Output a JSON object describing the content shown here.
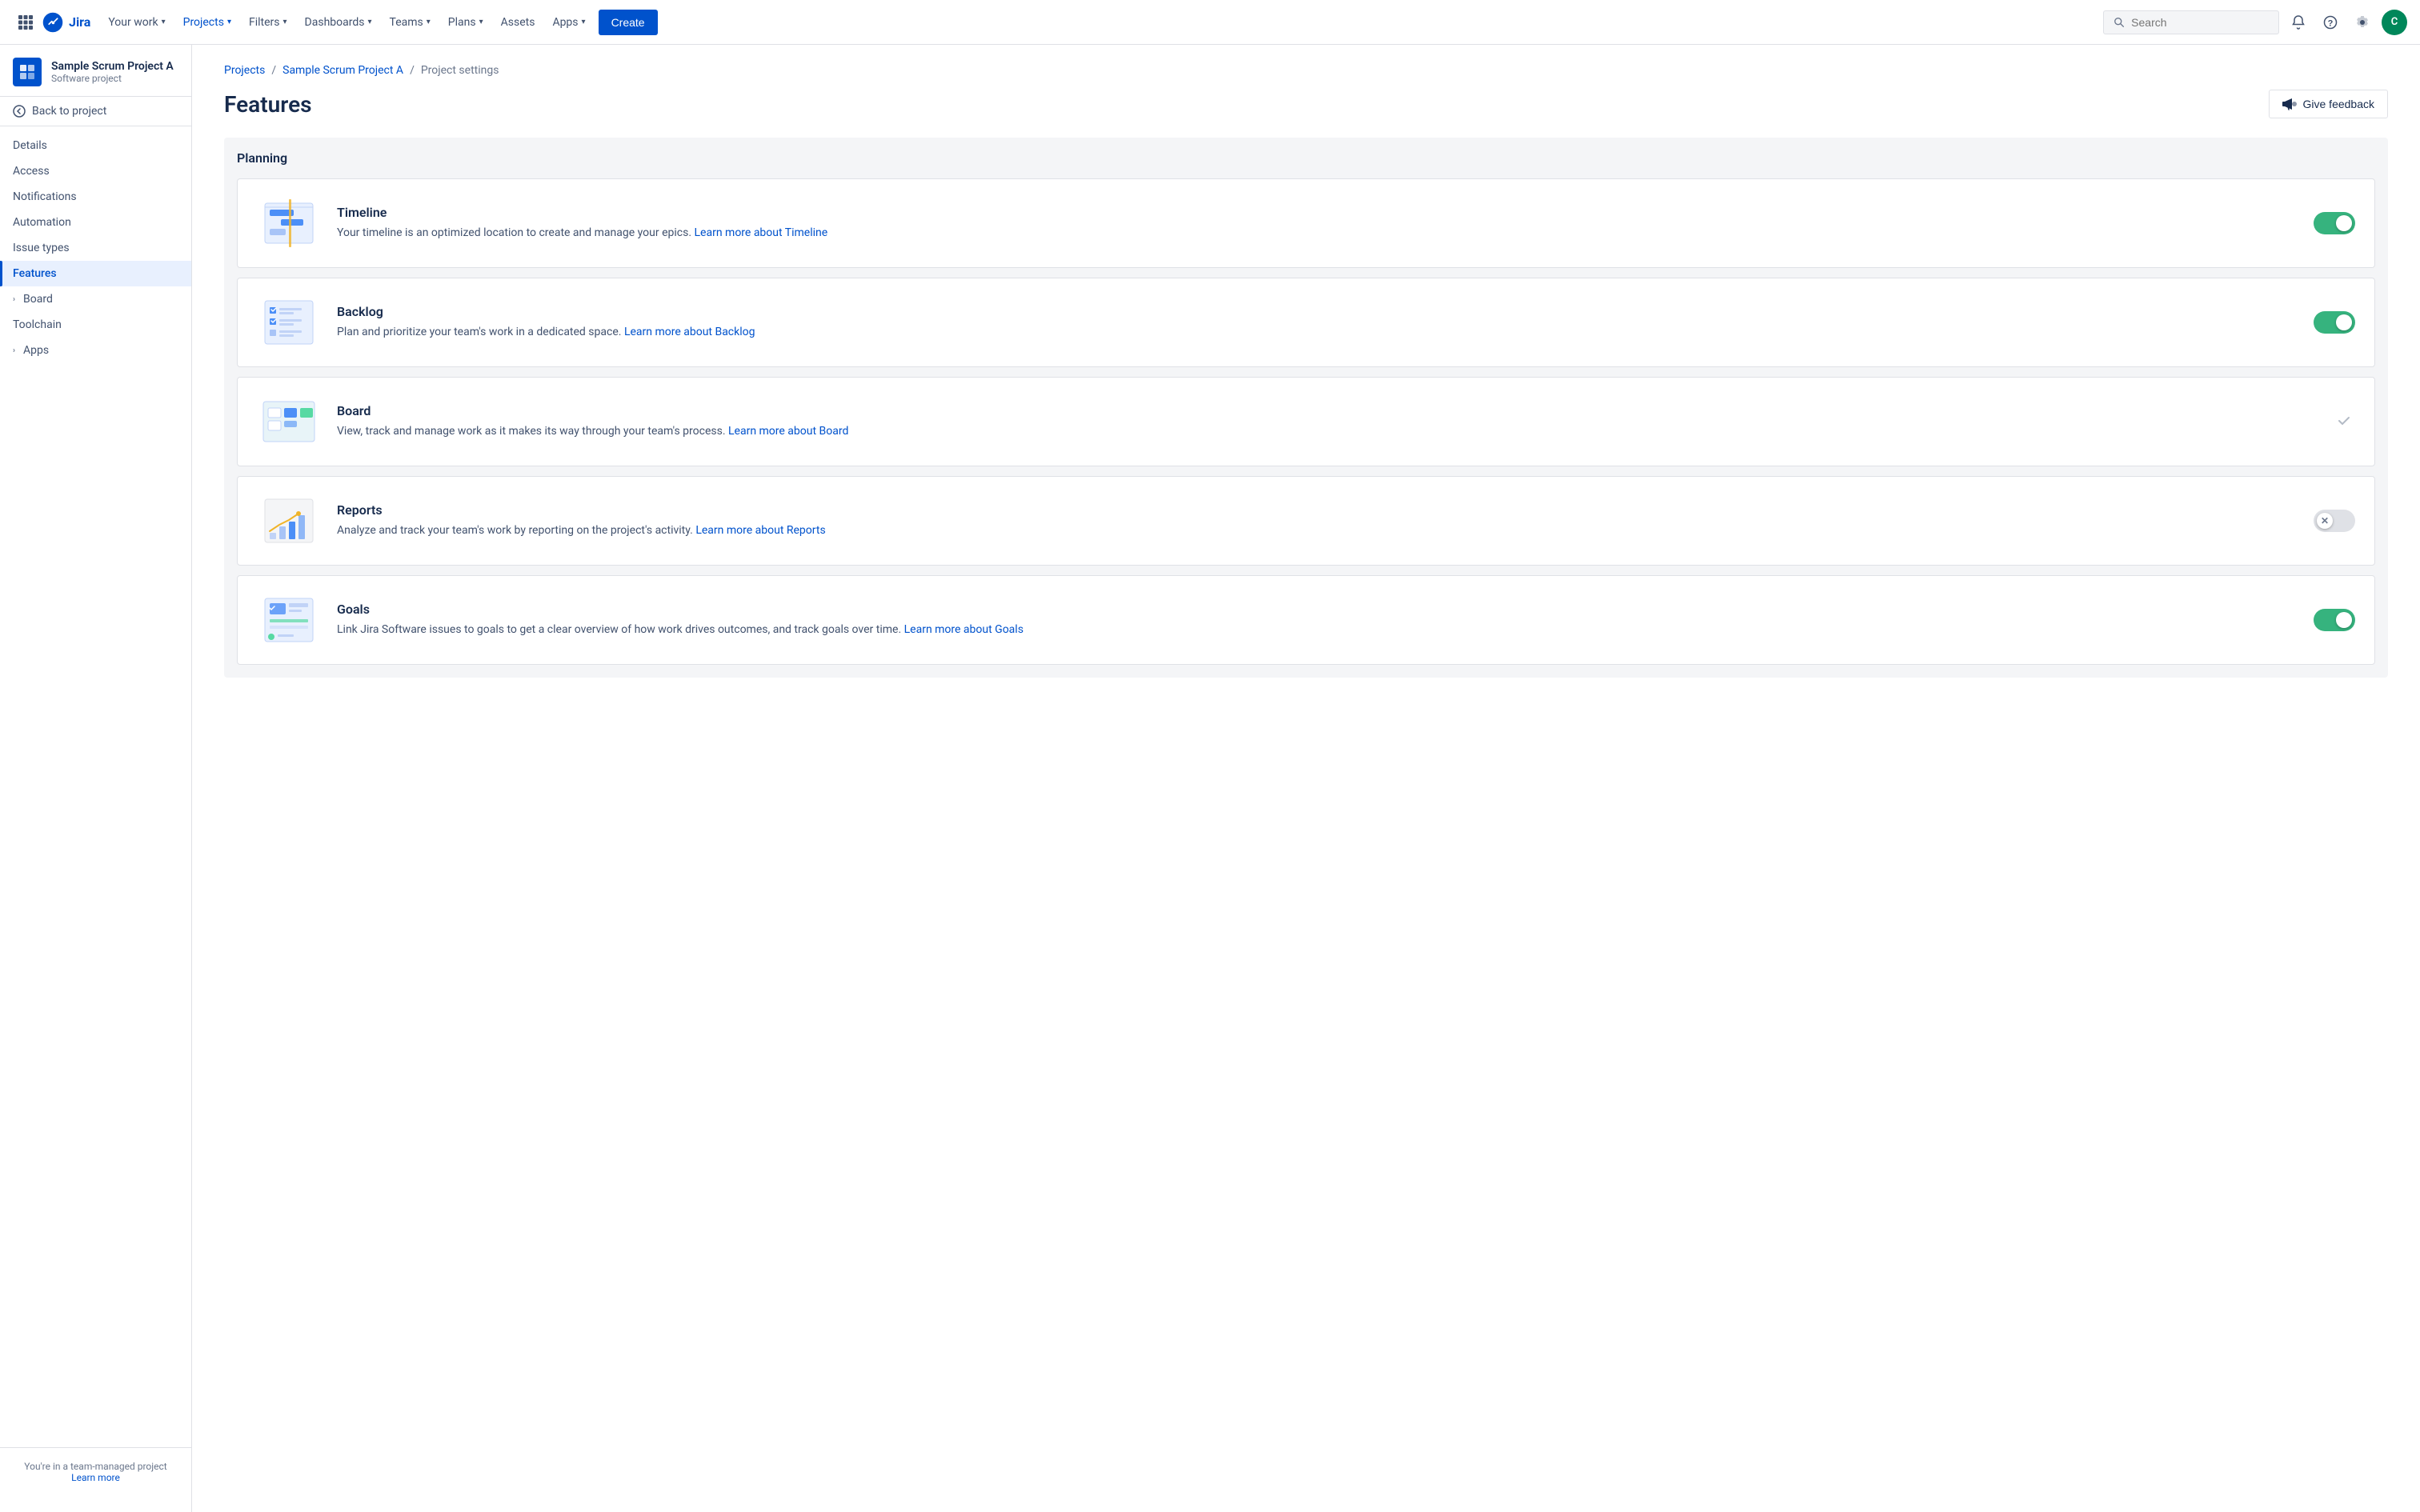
{
  "topnav": {
    "logo_text": "Jira",
    "your_work": "Your work",
    "projects": "Projects",
    "filters": "Filters",
    "dashboards": "Dashboards",
    "teams": "Teams",
    "plans": "Plans",
    "assets": "Assets",
    "apps": "Apps",
    "create_label": "Create",
    "search_placeholder": "Search",
    "avatar_initials": "C"
  },
  "sidebar": {
    "project_name": "Sample Scrum Project A",
    "project_type": "Software project",
    "back_label": "Back to project",
    "nav_items": [
      {
        "label": "Details",
        "active": false,
        "expandable": false
      },
      {
        "label": "Access",
        "active": false,
        "expandable": false
      },
      {
        "label": "Notifications",
        "active": false,
        "expandable": false
      },
      {
        "label": "Automation",
        "active": false,
        "expandable": false
      },
      {
        "label": "Issue types",
        "active": false,
        "expandable": false
      },
      {
        "label": "Features",
        "active": true,
        "expandable": false
      },
      {
        "label": "Board",
        "active": false,
        "expandable": true
      },
      {
        "label": "Toolchain",
        "active": false,
        "expandable": false
      },
      {
        "label": "Apps",
        "active": false,
        "expandable": true
      }
    ],
    "footer_text": "You're in a team-managed project",
    "footer_link": "Learn more"
  },
  "breadcrumb": {
    "items": [
      "Projects",
      "Sample Scrum Project A",
      "Project settings"
    ]
  },
  "page": {
    "title": "Features",
    "give_feedback": "Give feedback"
  },
  "planning": {
    "section_title": "Planning",
    "features": [
      {
        "name": "Timeline",
        "desc": "Your timeline is an optimized location to create and manage your epics.",
        "link_text": "Learn more about Timeline",
        "toggle_state": "on",
        "can_toggle": true
      },
      {
        "name": "Backlog",
        "desc": "Plan and prioritize your team's work in a dedicated space.",
        "link_text": "Learn more about Backlog",
        "toggle_state": "on",
        "can_toggle": true
      },
      {
        "name": "Board",
        "desc": "View, track and manage work as it makes its way through your team's process.",
        "link_text": "Learn more about Board",
        "toggle_state": "disabled",
        "can_toggle": false
      },
      {
        "name": "Reports",
        "desc": "Analyze and track your team's work by reporting on the project's activity.",
        "link_text": "Learn more about Reports",
        "toggle_state": "off",
        "can_toggle": true
      },
      {
        "name": "Goals",
        "desc": "Link Jira Software issues to goals to get a clear overview of how work drives outcomes, and track goals over time.",
        "link_text": "Learn more about Goals",
        "toggle_state": "on",
        "can_toggle": true
      }
    ]
  }
}
